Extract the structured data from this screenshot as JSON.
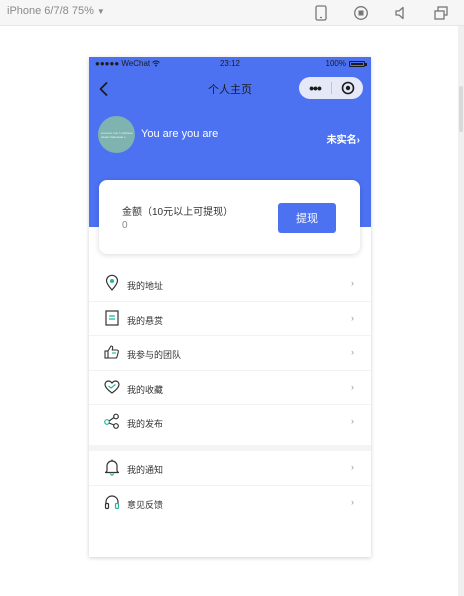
{
  "devtools": {
    "device_label": "iPhone 6/7/8 75%",
    "icons": [
      "phone-icon",
      "record-icon",
      "volume-icon",
      "windows-icon"
    ]
  },
  "statusbar": {
    "carrier": "●●●●● WeChat",
    "time": "23:12",
    "battery": "100%"
  },
  "navbar": {
    "title": "个人主页",
    "capsule_dots": "•••"
  },
  "profile": {
    "username": "You are you are",
    "verify_label": "未实名",
    "verify_arrow": "›",
    "avatar_text_line1": "scnoooo nou h stsbisaa",
    "avatar_text_line2": "ebaan thabuawa o"
  },
  "balance_card": {
    "label": "金额（10元以上可提现）",
    "amount": "0",
    "withdraw_label": "提现"
  },
  "menu_primary": [
    {
      "label": "我的地址",
      "icon": "location-pin-icon"
    },
    {
      "label": "我的悬赏",
      "icon": "document-icon"
    },
    {
      "label": "我参与的团队",
      "icon": "thumbs-up-icon"
    },
    {
      "label": "我的收藏",
      "icon": "heart-icon"
    },
    {
      "label": "我的发布",
      "icon": "share-icon"
    }
  ],
  "menu_secondary": [
    {
      "label": "我的通知",
      "icon": "bell-icon"
    },
    {
      "label": "意见反馈",
      "icon": "headphones-icon"
    }
  ],
  "arrow_glyph": "›",
  "colors": {
    "brand": "#4c72f2",
    "icon_teal": "#2bb3a0"
  }
}
